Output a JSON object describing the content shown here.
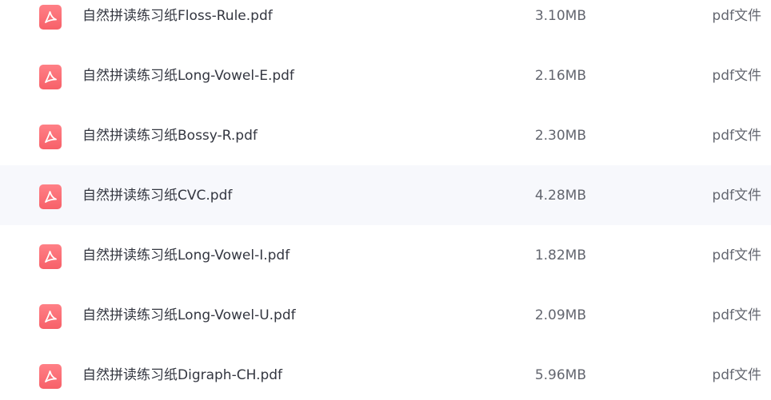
{
  "colors": {
    "pdf_icon": "#fa6c73",
    "row_hover_background": "#f7f8fc",
    "name_text": "#333640",
    "meta_text": "#63666f"
  },
  "files": [
    {
      "name": "自然拼读练习纸Floss-Rule.pdf",
      "size": "3.10MB",
      "type": "pdf文件",
      "icon": "pdf-file-icon"
    },
    {
      "name": "自然拼读练习纸Long-Vowel-E.pdf",
      "size": "2.16MB",
      "type": "pdf文件",
      "icon": "pdf-file-icon"
    },
    {
      "name": "自然拼读练习纸Bossy-R.pdf",
      "size": "2.30MB",
      "type": "pdf文件",
      "icon": "pdf-file-icon"
    },
    {
      "name": "自然拼读练习纸CVC.pdf",
      "size": "4.28MB",
      "type": "pdf文件",
      "icon": "pdf-file-icon",
      "hovered": true
    },
    {
      "name": "自然拼读练习纸Long-Vowel-I.pdf",
      "size": "1.82MB",
      "type": "pdf文件",
      "icon": "pdf-file-icon"
    },
    {
      "name": "自然拼读练习纸Long-Vowel-U.pdf",
      "size": "2.09MB",
      "type": "pdf文件",
      "icon": "pdf-file-icon"
    },
    {
      "name": "自然拼读练习纸Digraph-CH.pdf",
      "size": "5.96MB",
      "type": "pdf文件",
      "icon": "pdf-file-icon"
    }
  ]
}
